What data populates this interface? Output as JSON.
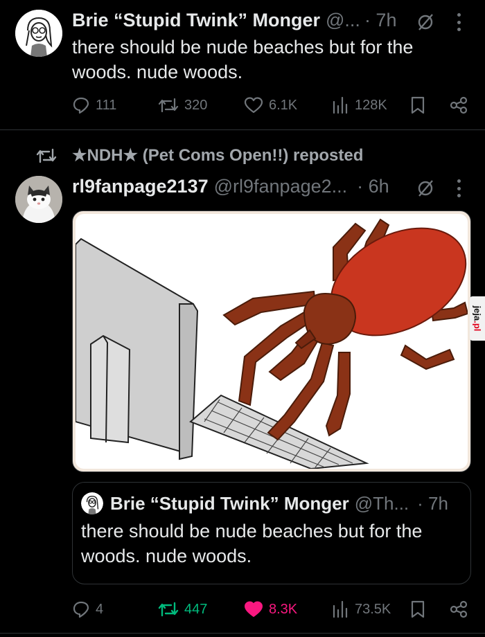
{
  "post1": {
    "name": "Brie “Stupid Twink” Monger",
    "handle": "@...",
    "time": "· 7h",
    "text_line1": "there should be nude beaches but for the",
    "text_line2": "woods. nude woods.",
    "replies": "111",
    "reposts": "320",
    "likes": "6.1K",
    "views": "128K"
  },
  "repost_label": "★NDH★ (Pet Coms Open!!) reposted",
  "post2": {
    "name": "rl9fanpage2137",
    "handle": "@rl9fanpage2...",
    "time": "· 6h",
    "image_icon": "tick-at-computer-drawing",
    "quote": {
      "name": "Brie “Stupid Twink” Monger",
      "handle": "@Th...",
      "time": "· 7h",
      "text_line1": "there should be nude beaches but for the",
      "text_line2": "woods. nude woods."
    },
    "replies": "4",
    "reposts": "447",
    "likes": "8.3K",
    "views": "73.5K"
  },
  "colors": {
    "repost_active": "#00ba7c",
    "like_active": "#f91880",
    "muted": "#71767b"
  },
  "watermark": {
    "prefix": "jeja",
    "suffix": ".pl"
  }
}
